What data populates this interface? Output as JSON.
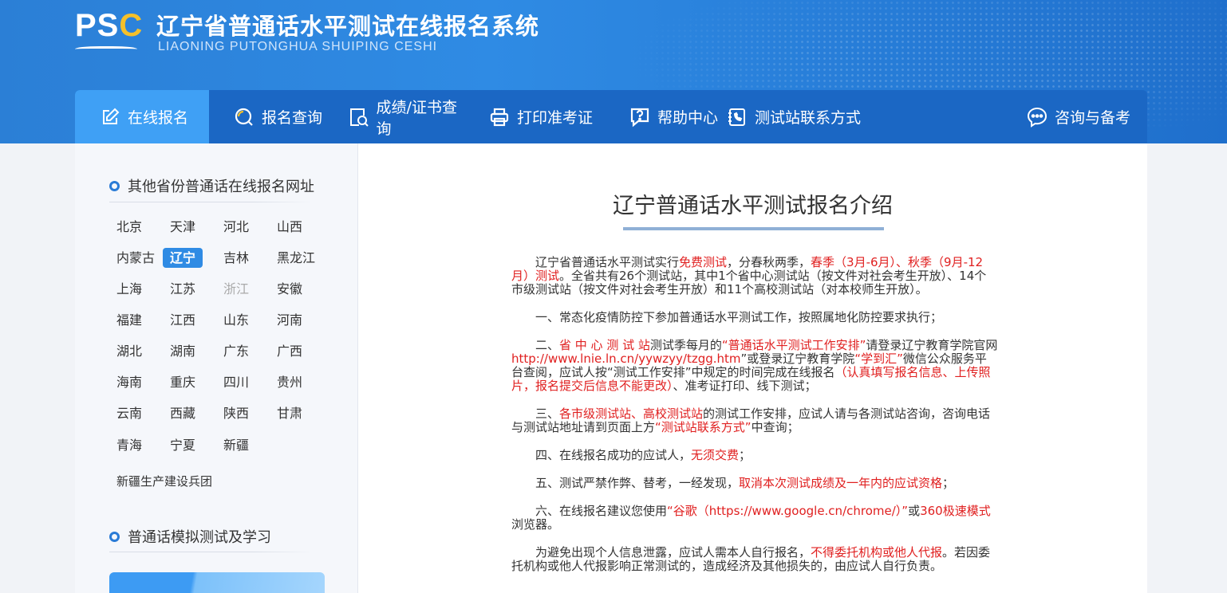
{
  "header": {
    "logo_text_ps": "PS",
    "logo_text_c": "C",
    "title": "辽宁省普通话水平测试在线报名系统",
    "subtitle": "LIAONING PUTONGHUA SHUIPING CESHI"
  },
  "nav": {
    "items": [
      {
        "label": "在线报名",
        "icon": "edit-icon"
      },
      {
        "label": "报名查询",
        "icon": "search-icon"
      },
      {
        "label": "成绩/证书查询",
        "icon": "certificate-search-icon"
      },
      {
        "label": "打印准考证",
        "icon": "printer-icon"
      },
      {
        "label": "帮助中心",
        "icon": "help-icon"
      },
      {
        "label": "测试站联系方式",
        "icon": "phone-book-icon"
      },
      {
        "label": "咨询与备考",
        "icon": "chat-icon"
      }
    ]
  },
  "sidebar": {
    "provinces_heading": "其他省份普通话在线报名网址",
    "provinces": [
      "北京",
      "天津",
      "河北",
      "山西",
      "内蒙古",
      "辽宁",
      "吉林",
      "黑龙江",
      "上海",
      "江苏",
      "浙江",
      "安徽",
      "福建",
      "江西",
      "山东",
      "河南",
      "湖北",
      "湖南",
      "广东",
      "广西",
      "海南",
      "重庆",
      "四川",
      "贵州",
      "云南",
      "西藏",
      "陕西",
      "甘肃",
      "青海",
      "宁夏",
      "新疆"
    ],
    "active_province": "辽宁",
    "dim_province": "浙江",
    "extra": "新疆生产建设兵团",
    "practice_heading": "普通话模拟测试及学习"
  },
  "content": {
    "title": "辽宁普通话水平测试报名介绍",
    "p1": {
      "a": "辽宁省普通话水平测试实行",
      "b": "免费测试",
      "c": "，分春秋两季，",
      "d": "春季（3月-6月）、秋季（9月-12月）测试",
      "e": "。全省共有26个测试站，其中1个省中心测试站（按文件对社会考生开放）、14个市级测试站（按文件对社会考生开放）和11个高校测试站（对本校师生开放）。"
    },
    "p2": "一、常态化疫情防控下参加普通话水平测试工作，按照属地化防控要求执行；",
    "p3": {
      "a": "二、",
      "b": "省 中 心 测 试 站",
      "c": "测试季每月的",
      "d": "“普通话水平测试工作安排”",
      "e": "请登录辽宁教育学院官网",
      "f": "http://www.lnie.ln.cn/yywzyy/tzgg.htm",
      "g": "”或登录辽宁教育学院",
      "h": "“学到汇”",
      "i": "微信公众服务平台查阅，应试人按“测试工作安排”中规定的时间完成在线报名",
      "j": "（认真填写报名信息、上传照片，报名提交后信息不能更改）",
      "k": "、准考证打印、线下测试；"
    },
    "p4": {
      "a": "三、",
      "b": "各市级测试站、高校测试站",
      "c": "的测试工作安排，应试人请与各测试站咨询，咨询电话与测试站地址请到页面上方",
      "d": "“测试站联系方式”",
      "e": "中查询；"
    },
    "p5": {
      "a": "四、在线报名成功的应试人，",
      "b": "无须交费",
      "c": "；"
    },
    "p6": {
      "a": "五、测试严禁作弊、替考，一经发现，",
      "b": "取消本次测试成绩及一年内的应试资格",
      "c": "；"
    },
    "p7": {
      "a": "六、在线报名建议您使用",
      "b": "“谷歌（https://www.google.cn/chrome/）”",
      "c": "或",
      "d": "360极速模式",
      "e": "浏览器。"
    },
    "p8": {
      "a": "为避免出现个人信息泄露，应试人需本人自行报名，",
      "b": "不得委托机构或他人代报",
      "c": "。若因委托机构或他人代报影响正常测试的，造成经济及其他损失的，由应试人自行负责。"
    }
  },
  "colors": {
    "header_blue": "#2f8be4",
    "nav_blue": "#1b67c4",
    "nav_active": "#3fa0f5",
    "highlight_red": "#e02020",
    "logo_yellow": "#f5c02a"
  }
}
